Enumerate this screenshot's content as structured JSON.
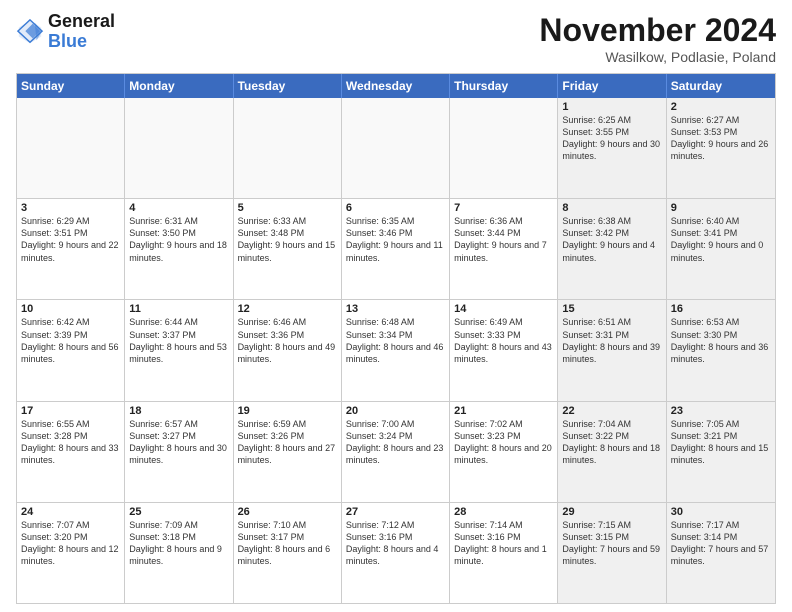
{
  "header": {
    "logo_line1": "General",
    "logo_line2": "Blue",
    "month_title": "November 2024",
    "location": "Wasilkow, Podlasie, Poland"
  },
  "days_of_week": [
    "Sunday",
    "Monday",
    "Tuesday",
    "Wednesday",
    "Thursday",
    "Friday",
    "Saturday"
  ],
  "rows": [
    [
      {
        "day": "",
        "text": "",
        "empty": true
      },
      {
        "day": "",
        "text": "",
        "empty": true
      },
      {
        "day": "",
        "text": "",
        "empty": true
      },
      {
        "day": "",
        "text": "",
        "empty": true
      },
      {
        "day": "",
        "text": "",
        "empty": true
      },
      {
        "day": "1",
        "text": "Sunrise: 6:25 AM\nSunset: 3:55 PM\nDaylight: 9 hours and 30 minutes.",
        "shaded": true
      },
      {
        "day": "2",
        "text": "Sunrise: 6:27 AM\nSunset: 3:53 PM\nDaylight: 9 hours and 26 minutes.",
        "shaded": true
      }
    ],
    [
      {
        "day": "3",
        "text": "Sunrise: 6:29 AM\nSunset: 3:51 PM\nDaylight: 9 hours and 22 minutes."
      },
      {
        "day": "4",
        "text": "Sunrise: 6:31 AM\nSunset: 3:50 PM\nDaylight: 9 hours and 18 minutes."
      },
      {
        "day": "5",
        "text": "Sunrise: 6:33 AM\nSunset: 3:48 PM\nDaylight: 9 hours and 15 minutes."
      },
      {
        "day": "6",
        "text": "Sunrise: 6:35 AM\nSunset: 3:46 PM\nDaylight: 9 hours and 11 minutes."
      },
      {
        "day": "7",
        "text": "Sunrise: 6:36 AM\nSunset: 3:44 PM\nDaylight: 9 hours and 7 minutes."
      },
      {
        "day": "8",
        "text": "Sunrise: 6:38 AM\nSunset: 3:42 PM\nDaylight: 9 hours and 4 minutes.",
        "shaded": true
      },
      {
        "day": "9",
        "text": "Sunrise: 6:40 AM\nSunset: 3:41 PM\nDaylight: 9 hours and 0 minutes.",
        "shaded": true
      }
    ],
    [
      {
        "day": "10",
        "text": "Sunrise: 6:42 AM\nSunset: 3:39 PM\nDaylight: 8 hours and 56 minutes."
      },
      {
        "day": "11",
        "text": "Sunrise: 6:44 AM\nSunset: 3:37 PM\nDaylight: 8 hours and 53 minutes."
      },
      {
        "day": "12",
        "text": "Sunrise: 6:46 AM\nSunset: 3:36 PM\nDaylight: 8 hours and 49 minutes."
      },
      {
        "day": "13",
        "text": "Sunrise: 6:48 AM\nSunset: 3:34 PM\nDaylight: 8 hours and 46 minutes."
      },
      {
        "day": "14",
        "text": "Sunrise: 6:49 AM\nSunset: 3:33 PM\nDaylight: 8 hours and 43 minutes."
      },
      {
        "day": "15",
        "text": "Sunrise: 6:51 AM\nSunset: 3:31 PM\nDaylight: 8 hours and 39 minutes.",
        "shaded": true
      },
      {
        "day": "16",
        "text": "Sunrise: 6:53 AM\nSunset: 3:30 PM\nDaylight: 8 hours and 36 minutes.",
        "shaded": true
      }
    ],
    [
      {
        "day": "17",
        "text": "Sunrise: 6:55 AM\nSunset: 3:28 PM\nDaylight: 8 hours and 33 minutes."
      },
      {
        "day": "18",
        "text": "Sunrise: 6:57 AM\nSunset: 3:27 PM\nDaylight: 8 hours and 30 minutes."
      },
      {
        "day": "19",
        "text": "Sunrise: 6:59 AM\nSunset: 3:26 PM\nDaylight: 8 hours and 27 minutes."
      },
      {
        "day": "20",
        "text": "Sunrise: 7:00 AM\nSunset: 3:24 PM\nDaylight: 8 hours and 23 minutes."
      },
      {
        "day": "21",
        "text": "Sunrise: 7:02 AM\nSunset: 3:23 PM\nDaylight: 8 hours and 20 minutes."
      },
      {
        "day": "22",
        "text": "Sunrise: 7:04 AM\nSunset: 3:22 PM\nDaylight: 8 hours and 18 minutes.",
        "shaded": true
      },
      {
        "day": "23",
        "text": "Sunrise: 7:05 AM\nSunset: 3:21 PM\nDaylight: 8 hours and 15 minutes.",
        "shaded": true
      }
    ],
    [
      {
        "day": "24",
        "text": "Sunrise: 7:07 AM\nSunset: 3:20 PM\nDaylight: 8 hours and 12 minutes."
      },
      {
        "day": "25",
        "text": "Sunrise: 7:09 AM\nSunset: 3:18 PM\nDaylight: 8 hours and 9 minutes."
      },
      {
        "day": "26",
        "text": "Sunrise: 7:10 AM\nSunset: 3:17 PM\nDaylight: 8 hours and 6 minutes."
      },
      {
        "day": "27",
        "text": "Sunrise: 7:12 AM\nSunset: 3:16 PM\nDaylight: 8 hours and 4 minutes."
      },
      {
        "day": "28",
        "text": "Sunrise: 7:14 AM\nSunset: 3:16 PM\nDaylight: 8 hours and 1 minute."
      },
      {
        "day": "29",
        "text": "Sunrise: 7:15 AM\nSunset: 3:15 PM\nDaylight: 7 hours and 59 minutes.",
        "shaded": true
      },
      {
        "day": "30",
        "text": "Sunrise: 7:17 AM\nSunset: 3:14 PM\nDaylight: 7 hours and 57 minutes.",
        "shaded": true
      }
    ]
  ]
}
